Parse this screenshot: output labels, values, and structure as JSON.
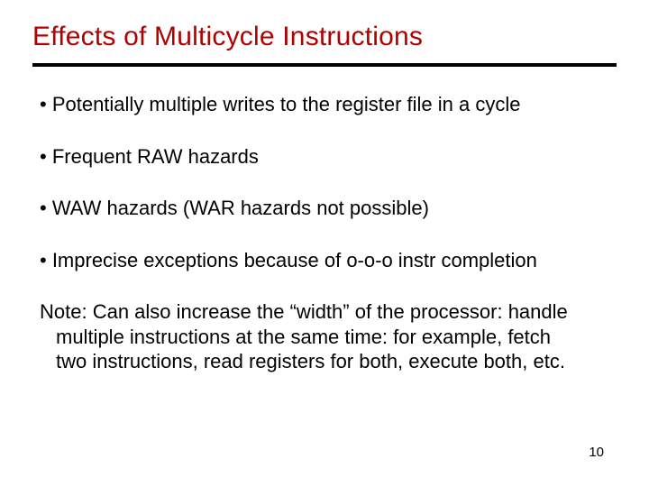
{
  "slide": {
    "title": "Effects of Multicycle Instructions",
    "bullets": [
      "• Potentially multiple writes to the register file in a cycle",
      "• Frequent RAW hazards",
      "• WAW hazards (WAR hazards not possible)",
      "• Imprecise exceptions because of o-o-o instr completion"
    ],
    "note_lines": [
      "Note: Can also increase the “width” of the processor: handle",
      "multiple instructions at the same time: for example, fetch",
      "two instructions, read registers for both, execute both, etc."
    ],
    "page_number": "10"
  }
}
